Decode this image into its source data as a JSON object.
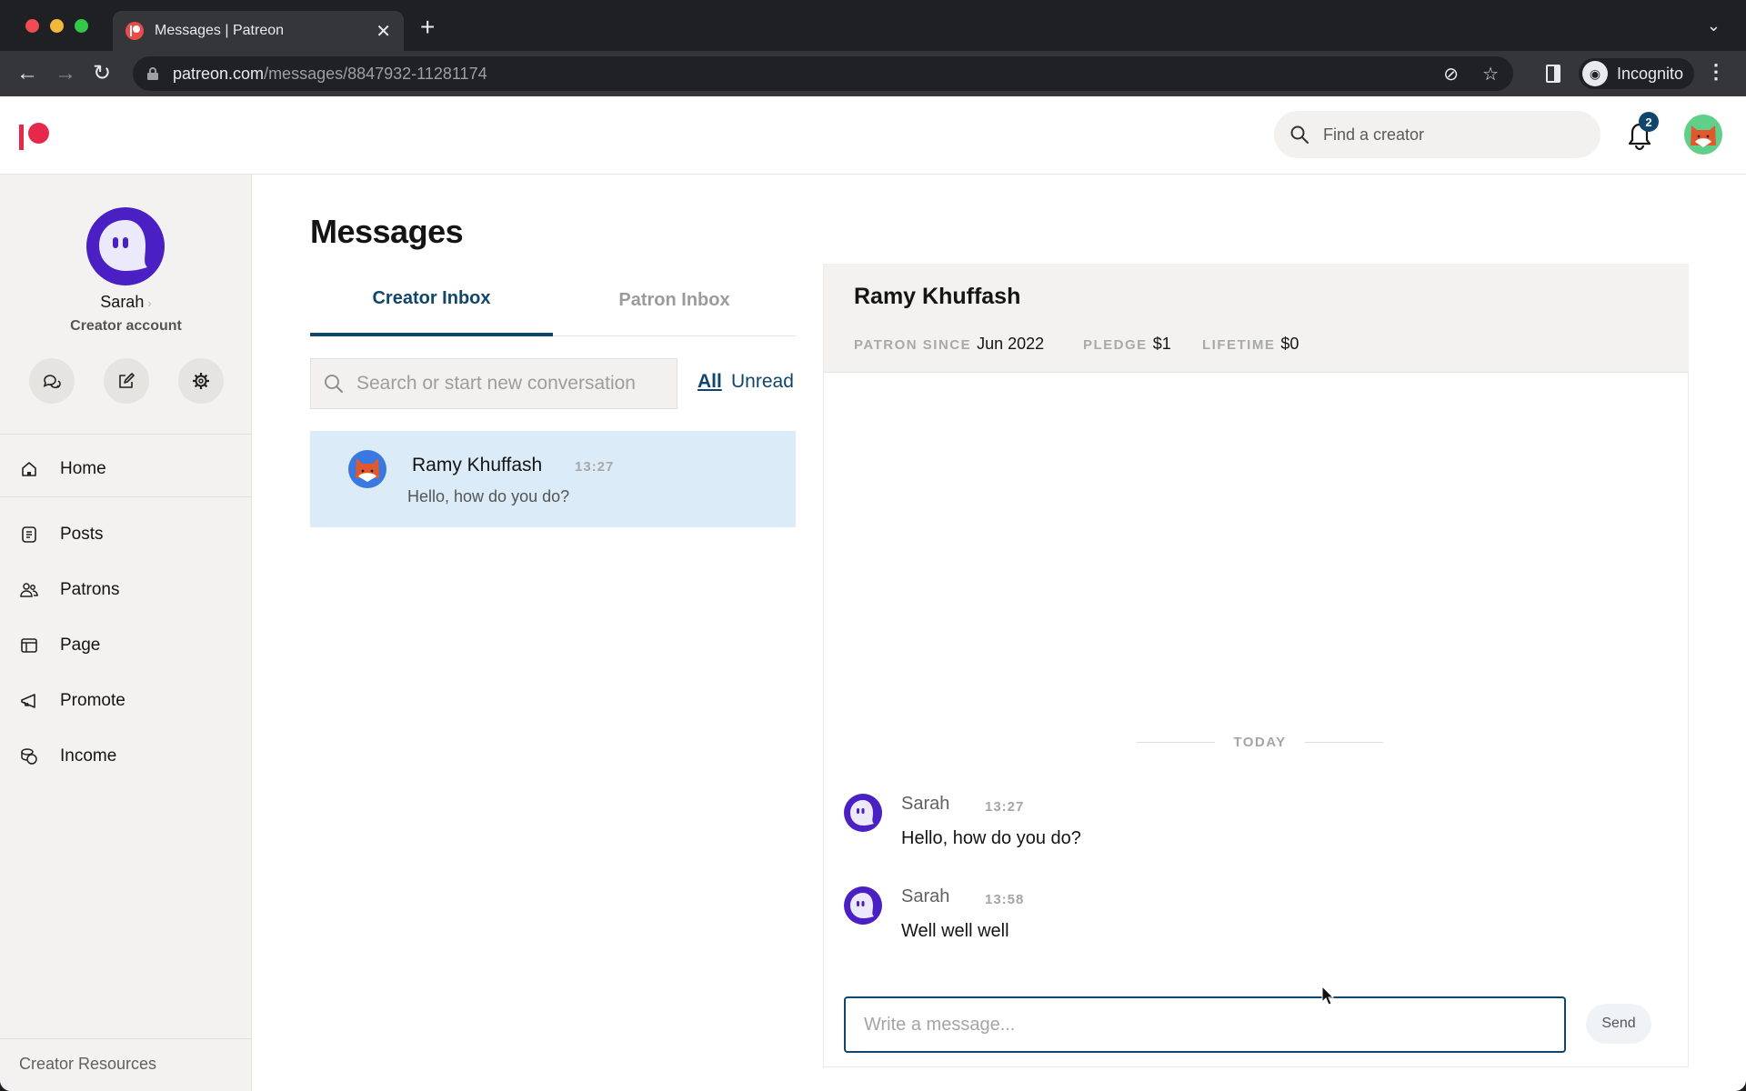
{
  "browser": {
    "tab_title": "Messages | Patreon",
    "url_host": "patreon.com",
    "url_path": "/messages/8847932-11281174",
    "profile_label": "Incognito",
    "icons": {
      "back": "arrow-left-icon",
      "forward": "arrow-right-icon",
      "reload": "reload-icon",
      "lock": "lock-icon",
      "eye_off": "eye-off-icon",
      "bookmark": "star-icon",
      "side_panel": "side-panel-icon",
      "incognito": "incognito-icon",
      "menu": "kebab-menu-icon"
    },
    "glyphs": {
      "close": "✕",
      "new_tab": "+",
      "dropdown": "⌄",
      "back": "←",
      "forward": "→",
      "reload": "↻",
      "eye_off": "⊘",
      "star": "☆",
      "incognito": "◉",
      "kebab": "⋮"
    }
  },
  "header": {
    "search_placeholder": "Find a creator",
    "notification_count": "2",
    "brand_color": "#e6284b",
    "accent_color": "#10466b"
  },
  "sidebar": {
    "user_name": "Sarah",
    "name_chevron": "›",
    "account_type": "Creator account",
    "actions": [
      {
        "name": "messages",
        "icon": "chat-bubbles-icon"
      },
      {
        "name": "create-post",
        "icon": "edit-icon"
      },
      {
        "name": "settings",
        "icon": "gear-icon"
      }
    ],
    "items": [
      {
        "label": "Home",
        "icon": "home-icon"
      },
      {
        "label": "Posts",
        "icon": "posts-icon"
      },
      {
        "label": "Patrons",
        "icon": "patrons-icon"
      },
      {
        "label": "Page",
        "icon": "page-layout-icon"
      },
      {
        "label": "Promote",
        "icon": "megaphone-icon"
      },
      {
        "label": "Income",
        "icon": "coins-icon"
      }
    ],
    "footer_link": "Creator Resources"
  },
  "main": {
    "title": "Messages",
    "tabs": [
      {
        "label": "Creator Inbox",
        "active": true
      },
      {
        "label": "Patron Inbox",
        "active": false
      }
    ],
    "search_placeholder": "Search or start new conversation",
    "filters": {
      "all": "All",
      "unread": "Unread",
      "selected": "All"
    },
    "conversations": [
      {
        "name": "Ramy Khuffash",
        "time": "13:27",
        "preview": "Hello, how do you do?",
        "selected": true
      }
    ]
  },
  "thread": {
    "name": "Ramy Khuffash",
    "meta": [
      {
        "label": "PATRON SINCE",
        "value": "Jun 2022"
      },
      {
        "label": "PLEDGE",
        "value": "$1"
      },
      {
        "label": "LIFETIME",
        "value": "$0"
      }
    ],
    "day_separator": "TODAY",
    "messages": [
      {
        "sender": "Sarah",
        "time": "13:27",
        "text": "Hello, how do you do?"
      },
      {
        "sender": "Sarah",
        "time": "13:58",
        "text": "Well well well"
      }
    ],
    "composer_placeholder": "Write a message...",
    "send_label": "Send"
  }
}
